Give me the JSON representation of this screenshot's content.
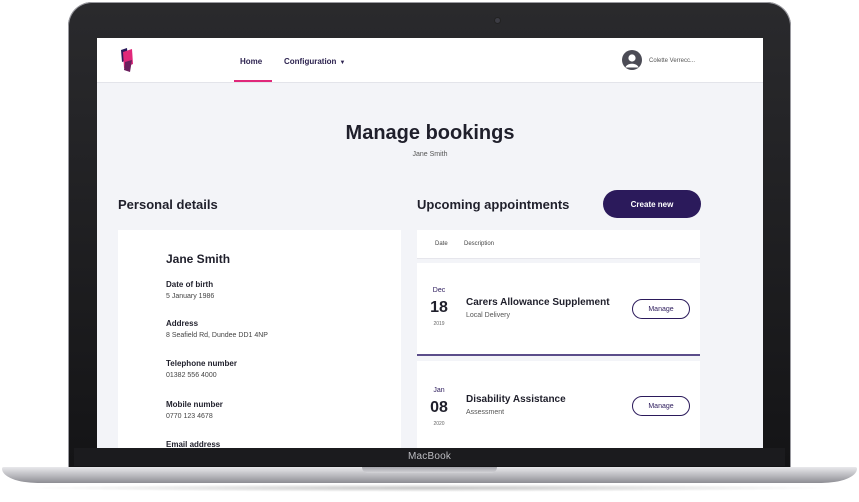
{
  "device": {
    "label": "MacBook"
  },
  "header": {
    "nav": [
      {
        "label": "Home",
        "active": true
      },
      {
        "label": "Configuration"
      }
    ],
    "user_name": "Colette Verrecc..."
  },
  "page": {
    "title": "Manage bookings",
    "subtitle": "Jane Smith"
  },
  "personal_details": {
    "heading": "Personal details",
    "name": "Jane Smith",
    "fields": [
      {
        "label": "Date of birth",
        "value": "5 January 1986"
      },
      {
        "label": "Address",
        "value": "8 Seafield Rd, Dundee DD1 4NP"
      },
      {
        "label": "Telephone number",
        "value": "01382 556 4000"
      },
      {
        "label": "Mobile number",
        "value": "0770 123 4678"
      },
      {
        "label": "Email address",
        "value": ""
      }
    ]
  },
  "appointments": {
    "heading": "Upcoming appointments",
    "create_label": "Create new",
    "columns": [
      "Date",
      "Description"
    ],
    "items": [
      {
        "month": "Dec",
        "day": "18",
        "year": "2019",
        "title": "Carers Allowance Supplement",
        "subtitle": "Local Delivery",
        "action": "Manage"
      },
      {
        "month": "Jan",
        "day": "08",
        "year": "2020",
        "title": "Disability Assistance",
        "subtitle": "Assessment",
        "action": "Manage"
      }
    ]
  },
  "colors": {
    "brand": "#2b1a5b",
    "accent": "#e0287a",
    "background": "#f3f4f8"
  },
  "icons": {
    "logo": "brand-logo",
    "avatar": "user-avatar-icon",
    "chevron": "chevron-down-icon"
  }
}
